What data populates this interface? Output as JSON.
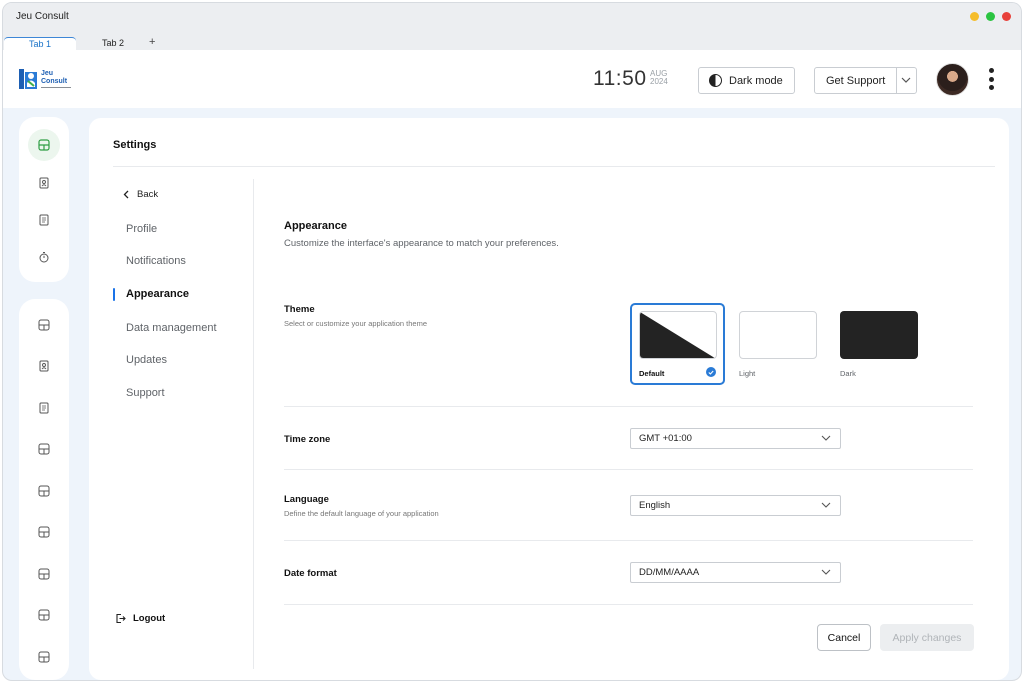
{
  "window": {
    "title": "Jeu Consult",
    "colors": {
      "yellow": "#f5bd2b",
      "green": "#2bc441",
      "red": "#e8413b"
    }
  },
  "tabs": [
    {
      "label": "Tab 1",
      "active": true
    },
    {
      "label": "Tab 2",
      "active": false
    }
  ],
  "tab_add_label": "+",
  "brand": {
    "name_line1": "Jeu",
    "name_line2": "Consult",
    "accent": "#1d5fb3"
  },
  "header": {
    "time": "11:50",
    "date_month": "AUG",
    "date_year": "2024",
    "dark_mode_label": "Dark mode",
    "support_label": "Get Support",
    "support_icon": "chevron-down-icon",
    "more_icon": "more-vertical-icon"
  },
  "rail": {
    "top_icons": [
      "dashboard-icon",
      "contact-card-icon",
      "document-icon",
      "timer-icon"
    ],
    "bottom_icons": [
      "layout-icon",
      "contact-card-icon",
      "document-icon",
      "layout-icon",
      "layout-icon",
      "layout-icon",
      "layout-icon",
      "layout-icon",
      "layout-icon"
    ]
  },
  "settings": {
    "title": "Settings",
    "back_label": "Back",
    "nav": [
      {
        "label": "Profile",
        "active": false
      },
      {
        "label": "Notifications",
        "active": false
      },
      {
        "label": "Appearance",
        "active": true
      },
      {
        "label": "Data management",
        "active": false
      },
      {
        "label": "Updates",
        "active": false
      },
      {
        "label": "Support",
        "active": false
      }
    ],
    "logout_label": "Logout"
  },
  "appearance": {
    "title": "Appearance",
    "subtitle": "Customize the interface's appearance to match your preferences.",
    "theme": {
      "label": "Theme",
      "description": "Select or customize your application theme",
      "options": [
        {
          "name": "Default",
          "selected": true
        },
        {
          "name": "Light",
          "selected": false
        },
        {
          "name": "Dark",
          "selected": false
        }
      ]
    },
    "timezone": {
      "label": "Time zone",
      "value": "GMT +01:00"
    },
    "language": {
      "label": "Language",
      "description": "Define the default language of your application",
      "value": "English"
    },
    "date_format": {
      "label": "Date format",
      "value": "DD/MM/AAAA"
    },
    "cancel_label": "Cancel",
    "apply_label": "Apply changes",
    "accent": "#2a7bd6"
  }
}
